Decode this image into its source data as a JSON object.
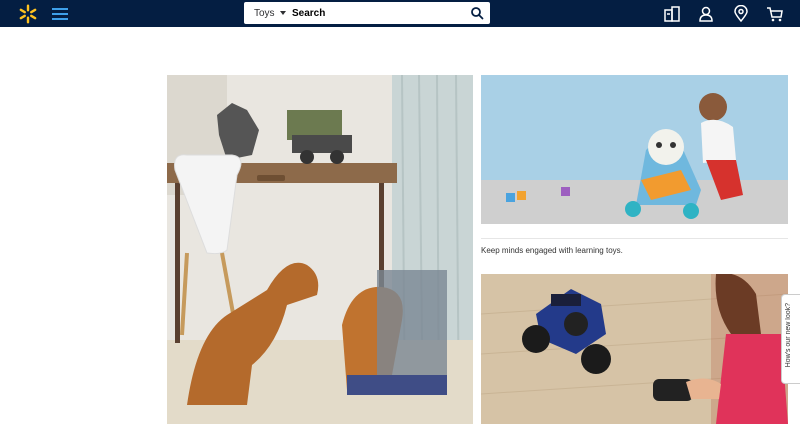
{
  "header": {
    "logo_icon": "walmart-spark-icon",
    "menu_icon": "hamburger-menu-icon",
    "search": {
      "department": "Toys",
      "placeholder": "Search"
    },
    "icons": [
      "reorder-icon",
      "account-icon",
      "store-location-icon",
      "cart-icon"
    ]
  },
  "main": {
    "hero_image": "dinosaur-toys-photo",
    "top_right_image": "baby-learning-walker-photo",
    "caption": "Keep minds engaged with learning toys.",
    "bottom_right_image": "rc-truck-photo"
  },
  "feedback": {
    "label": "How's our new look?"
  },
  "colors": {
    "header_bg": "#041e42",
    "spark": "#ffc220",
    "menu": "#3ea0ea"
  }
}
